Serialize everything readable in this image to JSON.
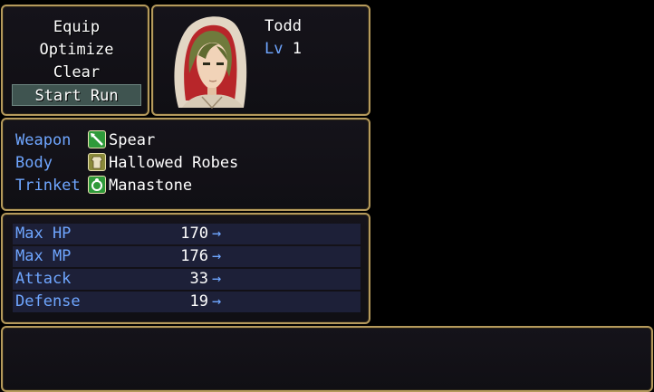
{
  "commands": [
    {
      "label": "Equip",
      "selected": false
    },
    {
      "label": "Optimize",
      "selected": false
    },
    {
      "label": "Clear",
      "selected": false
    },
    {
      "label": "Start Run",
      "selected": true
    }
  ],
  "actor": {
    "name": "Todd",
    "level_label": "Lv",
    "level": "1"
  },
  "slots": [
    {
      "label": "Weapon",
      "icon": "spear-icon",
      "icon_color": "#2f9a3a",
      "item": "Spear"
    },
    {
      "label": "Body",
      "icon": "robe-icon",
      "icon_color": "#8a8a3a",
      "item": "Hallowed Robes"
    },
    {
      "label": "Trinket",
      "icon": "ring-icon",
      "icon_color": "#2f9a3a",
      "item": "Manastone"
    }
  ],
  "stats": [
    {
      "label": "Max HP",
      "value": "170",
      "arrow": "→"
    },
    {
      "label": "Max MP",
      "value": "176",
      "arrow": "→"
    },
    {
      "label": "Attack",
      "value": "33",
      "arrow": "→"
    },
    {
      "label": "Defense",
      "value": "19",
      "arrow": "→"
    }
  ],
  "colors": {
    "system_blue": "#6fa6ff",
    "frame_gold": "#b59a5c",
    "selection": "#3f5450"
  }
}
